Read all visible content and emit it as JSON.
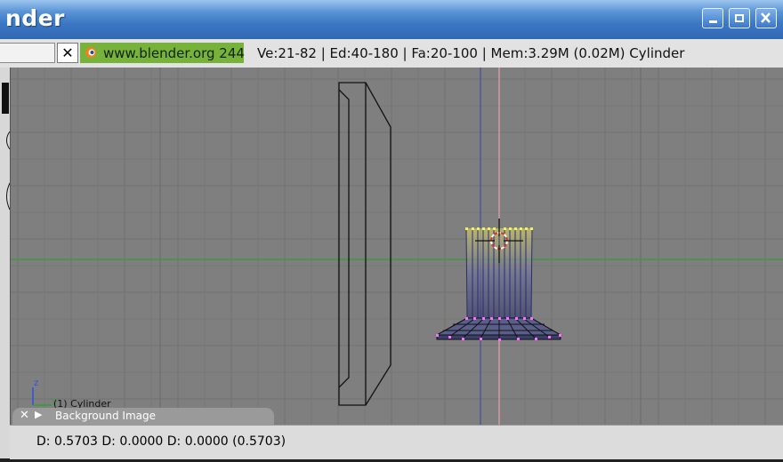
{
  "window": {
    "title": "nder",
    "buttons": {
      "minimize": "minimize-icon",
      "maximize": "maximize-icon",
      "close": "close-icon"
    }
  },
  "header": {
    "close_label": "✕",
    "logo_icon": "blender-logo-icon",
    "version_label": "www.blender.org 244",
    "stats": "Ve:21-82 | Ed:40-180 | Fa:20-100 | Mem:3.29M (0.02M) Cylinder"
  },
  "viewport": {
    "object_label": "(1) Cylinder",
    "axis_labels": {
      "z": "z",
      "y": "y"
    },
    "background_panel": {
      "close": "✕",
      "expand": "▶",
      "label": "Background Image"
    }
  },
  "footer": {
    "transform_text": "D: 0.5703   D: 0.0000  D: 0.0000 (0.5703)"
  },
  "colors": {
    "title_bar": "#3b78c4",
    "viewport_bg": "#7f7f7f",
    "grid_line": "#6f6f6f",
    "x_axis": "#3c9a3c",
    "y_axis_blue": "#4a4aa0",
    "guide_pink": "#e8a0b0",
    "vertex_yellow": "#f0f060",
    "vertex_pink": "#ff70ff",
    "logo_green": "#77b23b"
  }
}
